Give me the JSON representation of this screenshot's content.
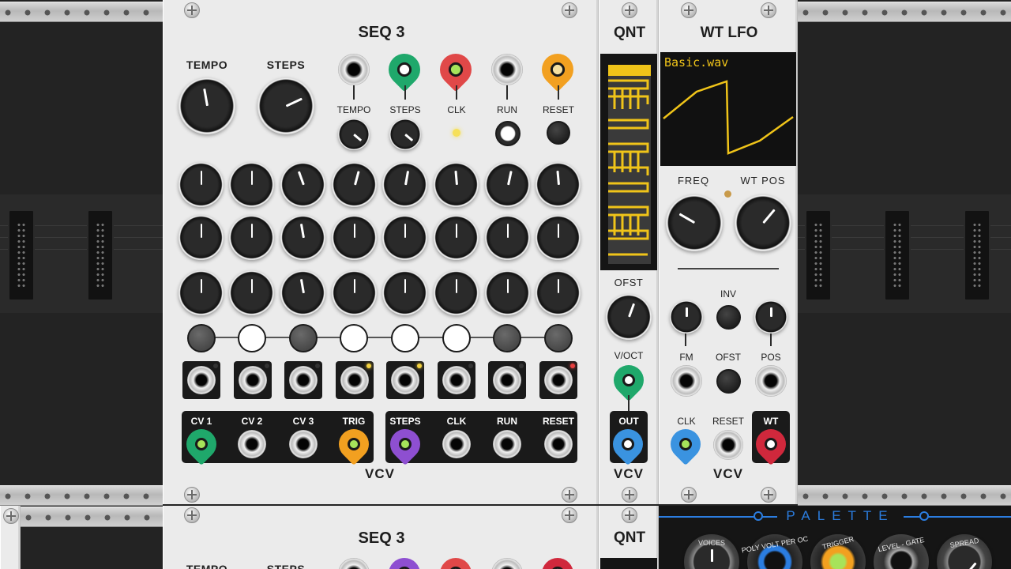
{
  "rack": {
    "background_color": "#232323",
    "rail_color": "#c8c8c8"
  },
  "seq3": {
    "title": "SEQ 3",
    "brand": "VCV",
    "top_knobs": [
      {
        "label": "TEMPO"
      },
      {
        "label": "STEPS"
      }
    ],
    "top_ports": [
      {
        "label": "TEMPO"
      },
      {
        "label": "STEPS"
      },
      {
        "label": "CLK"
      },
      {
        "label": "RUN"
      },
      {
        "label": "RESET"
      }
    ],
    "outputs_left": [
      {
        "label": "CV 1"
      },
      {
        "label": "CV 2"
      },
      {
        "label": "CV 3"
      },
      {
        "label": "TRIG"
      }
    ],
    "outputs_right": [
      {
        "label": "STEPS"
      },
      {
        "label": "CLK"
      },
      {
        "label": "RUN"
      },
      {
        "label": "RESET"
      }
    ]
  },
  "qnt": {
    "title": "QNT",
    "brand": "VCV",
    "knob_label": "OFST",
    "input_label": "V/OCT",
    "output_label": "OUT",
    "keyboard_color": "#f0c419"
  },
  "wtlfo": {
    "title": "WT LFO",
    "brand": "VCV",
    "display_text": "Basic.wav",
    "display_color": "#f0c419",
    "knobs": [
      {
        "label": "FREQ"
      },
      {
        "label": "WT POS"
      }
    ],
    "mid_labels": {
      "inv": "INV",
      "fm": "FM",
      "ofst": "OFST",
      "pos": "POS"
    },
    "bottom_labels": {
      "clk": "CLK",
      "reset": "RESET",
      "wt": "WT"
    }
  },
  "seq3_lower": {
    "title": "SEQ 3",
    "labels": {
      "tempo": "TEMPO",
      "steps": "STEPS"
    }
  },
  "qnt_lower": {
    "title": "QNT"
  },
  "palette": {
    "title": "PALETTE",
    "knob_labels": [
      "VOICES",
      "POLY VOLT PER OC",
      "TRIGGER",
      "LEVEL - GATE",
      "SPREAD"
    ],
    "accent": "#2b7de0"
  },
  "cable_colors": {
    "green": "#1fa86b",
    "red": "#e04848",
    "orange": "#f2a020",
    "blue": "#3a93e0",
    "purple": "#8e4fd1",
    "crimson": "#d0283c"
  }
}
